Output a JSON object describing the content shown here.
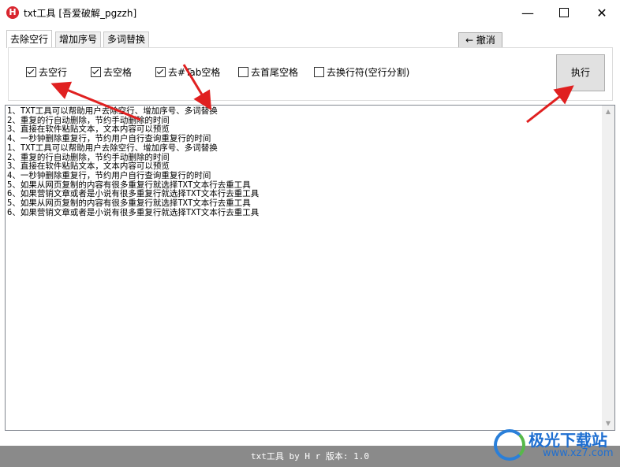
{
  "window": {
    "app_icon_letter": "H",
    "title": "txt工具 [吾爱破解_pgzzh]"
  },
  "tabs": [
    "去除空行",
    "增加序号",
    "多词替换"
  ],
  "toolbar": {
    "undo_label": "← 撤消",
    "execute_label": "执行"
  },
  "options": [
    {
      "label": "去空行",
      "checked": true
    },
    {
      "label": "去空格",
      "checked": true
    },
    {
      "label": "去#Tab空格",
      "checked": true
    },
    {
      "label": "去首尾空格",
      "checked": false
    },
    {
      "label": "去换行符(空行分割)",
      "checked": false
    }
  ],
  "text_lines": [
    "1、TXT工具可以帮助用户去除空行、增加序号、多词替换",
    "2、重复的行自动删除，节约手动删除的时间",
    "3、直接在软件粘贴文本，文本内容可以预览",
    "4、一秒钟删除重复行，节约用户自行查询重复行的时间",
    "1、TXT工具可以帮助用户去除空行、增加序号、多词替换",
    "2、重复的行自动删除，节约手动删除的时间",
    "3、直接在软件粘贴文本，文本内容可以预览",
    "4、一秒钟删除重复行，节约用户自行查询重复行的时间",
    "5、如果从网页复制的内容有很多重复行就选择TXT文本行去重工具",
    "6、如果营销文章或者是小说有很多重复行就选择TXT文本行去重工具",
    "5、如果从网页复制的内容有很多重复行就选择TXT文本行去重工具",
    "6、如果营销文章或者是小说有很多重复行就选择TXT文本行去重工具"
  ],
  "footer": {
    "text": "txt工具 by H r  版本: 1.0"
  },
  "watermark": {
    "name": "极光下载站",
    "url": "www.xz7.com"
  },
  "colors": {
    "annotation_arrow": "#e02020",
    "footer_bg": "#8a8a8a",
    "watermark": "#1f6fd1"
  }
}
